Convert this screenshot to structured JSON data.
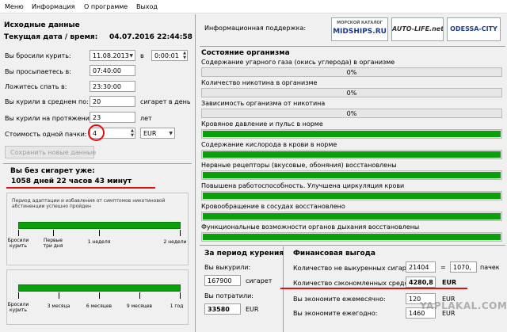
{
  "menu": [
    "Меню",
    "Информация",
    "О программе",
    "Выход"
  ],
  "left": {
    "title": "Исходные данные",
    "current_label": "Текущая дата / время:",
    "current_value": "04.07.2016 22:44:58",
    "quit_label": "Вы бросили курить:",
    "quit_date": "11.08.2013",
    "quit_in": "в",
    "quit_time": "0:00:01",
    "wake_label": "Вы просыпаетесь в:",
    "wake_value": "07:40:00",
    "sleep_label": "Ложитесь спать в:",
    "sleep_value": "23:30:00",
    "avg_label": "Вы курили в среднем по:",
    "avg_value": "20",
    "avg_unit": "сигарет в день",
    "years_label": "Вы курили на протяжении:",
    "years_value": "23",
    "years_unit": "лет",
    "price_label": "Стоимость одной пачки:",
    "price_value": "4",
    "currency": "EUR",
    "save_btn": "Сохранить новые данные",
    "without_label": "Вы без сигарет уже:",
    "without_value": "1058 дней  22 часов  43 минут",
    "adapt_text": "Период адаптации и избавления от симптомов никотиновой абстиненции успешно пройден",
    "timeline1": [
      {
        "label": "Бросили курить"
      },
      {
        "label": "Первые три дня"
      },
      {
        "label": "1 неделя"
      },
      {
        "label": "2 недели"
      }
    ],
    "timeline2": [
      {
        "label": "Бросили курить"
      },
      {
        "label": "3 месяца"
      },
      {
        "label": "6 месяцев"
      },
      {
        "label": "9 месяцев"
      },
      {
        "label": "1 год"
      }
    ]
  },
  "right": {
    "support_label": "Информационная поддержка:",
    "logos": [
      {
        "top": "МОРСКОЙ КАТАЛОГ",
        "main": "MIDSHIPS.RU"
      },
      {
        "main": "AUTO-LIFE.net"
      },
      {
        "main": "ODESSA-CITY"
      }
    ],
    "state_title": "Состояние организма",
    "rows": [
      {
        "label": "Содержание угарного газа (окись углерода) в организме",
        "fill": 0,
        "text": "0%"
      },
      {
        "label": "Количество никотина в организме",
        "fill": 0,
        "text": "0%"
      },
      {
        "label": "Зависимость организма от никотина",
        "fill": 0,
        "text": "0%"
      },
      {
        "label": "Кровяное давление и пульс в норме",
        "fill": 1,
        "text": ""
      },
      {
        "label": "Содержание кислорода в крови в норме",
        "fill": 1,
        "text": ""
      },
      {
        "label": "Нервные рецепторы (вкусовые, обоняния) восстановлены",
        "fill": 1,
        "text": ""
      },
      {
        "label": "Повышена работоспособность. Улучшена циркуляция крови",
        "fill": 1,
        "text": ""
      },
      {
        "label": "Кровообращение в сосудах восстановлено",
        "fill": 1,
        "text": ""
      },
      {
        "label": "Функциональные возможности органов дыхания восстановлены",
        "fill": 1,
        "text": ""
      }
    ],
    "period_title": "За период курения",
    "smoked_label": "Вы выкурили:",
    "smoked_value": "167900",
    "smoked_unit": "сигарет",
    "spent_label": "Вы потратили:",
    "spent_value": "33580",
    "spent_unit": "EUR",
    "fin_title": "Финансовая выгода",
    "notsmoked_label": "Количество не выкуренных сигарет:",
    "notsmoked_value": "21404",
    "eq": "=",
    "packs_value": "1070,",
    "packs_unit": "пачек",
    "saved_label": "Количество сэкономленных средств:",
    "saved_value": "4280,8",
    "saved_unit": "EUR",
    "monthly_label": "Вы экономите ежемесячно:",
    "monthly_value": "120",
    "monthly_unit": "EUR",
    "yearly_label": "Вы экономите ежегодно:",
    "yearly_value": "1460",
    "yearly_unit": "EUR",
    "watermark": "YAPLAKAL.COM"
  },
  "colors": {
    "green": "#09a009",
    "red": "#e01010"
  }
}
